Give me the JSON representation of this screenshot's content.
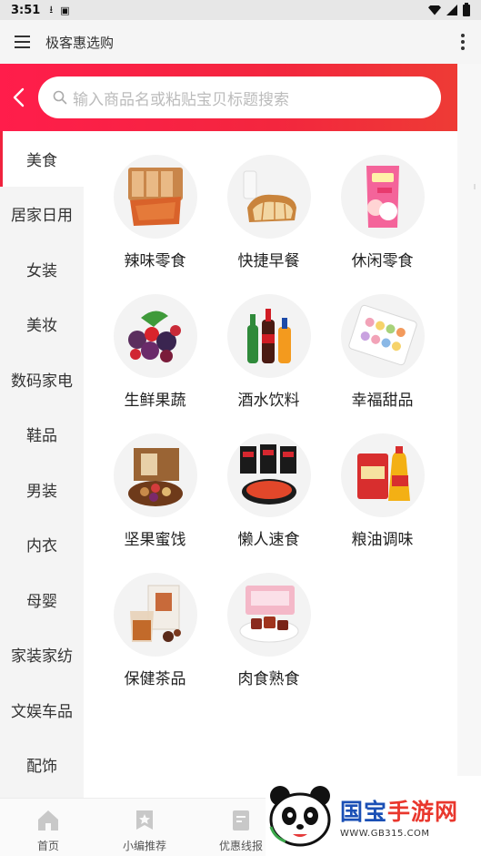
{
  "status_bar": {
    "time": "3:51"
  },
  "toolbar": {
    "title": "极客惠选购"
  },
  "search": {
    "placeholder": "输入商品名或粘贴宝贝标题搜索"
  },
  "sidebar": {
    "items": [
      {
        "label": "美食",
        "active": true
      },
      {
        "label": "居家日用"
      },
      {
        "label": "女装"
      },
      {
        "label": "美妆"
      },
      {
        "label": "数码家电"
      },
      {
        "label": "鞋品"
      },
      {
        "label": "男装"
      },
      {
        "label": "内衣"
      },
      {
        "label": "母婴"
      },
      {
        "label": "家装家纺"
      },
      {
        "label": "文娱车品"
      },
      {
        "label": "配饰"
      }
    ]
  },
  "grid": {
    "items": [
      {
        "label": "辣味零食",
        "icon": "spicy-snack-icon"
      },
      {
        "label": "快捷早餐",
        "icon": "bread-icon"
      },
      {
        "label": "休闲零食",
        "icon": "snack-bag-icon"
      },
      {
        "label": "生鲜果蔬",
        "icon": "berries-icon"
      },
      {
        "label": "酒水饮料",
        "icon": "drinks-icon"
      },
      {
        "label": "幸福甜品",
        "icon": "macaron-icon"
      },
      {
        "label": "坚果蜜饯",
        "icon": "nuts-icon"
      },
      {
        "label": "懒人速食",
        "icon": "instant-noodle-icon"
      },
      {
        "label": "粮油调味",
        "icon": "rice-oil-icon"
      },
      {
        "label": "保健茶品",
        "icon": "tea-icon"
      },
      {
        "label": "肉食熟食",
        "icon": "meat-icon"
      }
    ]
  },
  "bottom_nav": {
    "items": [
      {
        "label": "首页",
        "icon": "home-icon"
      },
      {
        "label": "小编推荐",
        "icon": "badge-icon"
      },
      {
        "label": "优惠线报",
        "icon": "document-icon"
      }
    ]
  },
  "watermark": {
    "title_a": "国宝",
    "title_b": "手游网",
    "url": "WWW.GB315.COM"
  },
  "colors": {
    "accent": "#f0223e",
    "header_red": "#ff1d4b",
    "watermark_blue": "#1a4fb5"
  }
}
